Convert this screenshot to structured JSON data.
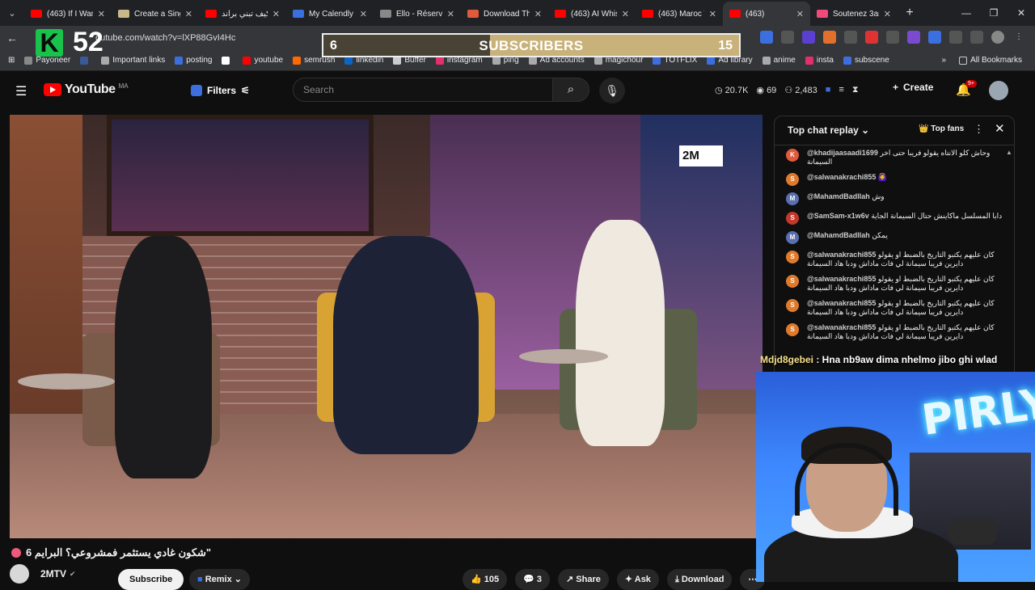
{
  "browser": {
    "tabs": [
      {
        "label": "(463) If I Want",
        "color": "#ff0000"
      },
      {
        "label": "Create a Single",
        "color": "#c9b98a"
      },
      {
        "label": "كيف تبني براند",
        "color": "#ff0000"
      },
      {
        "label": "My Calendly",
        "color": "#3b6fe0"
      },
      {
        "label": "Ello - Réservat",
        "color": "#888888"
      },
      {
        "label": "Download Th",
        "color": "#e05a3b"
      },
      {
        "label": "(463) AI Whisk",
        "color": "#ff0000"
      },
      {
        "label": "(463) Maroc T",
        "color": "#ff0000"
      },
      {
        "label": "(463)",
        "color": "#ff0000",
        "active": true
      },
      {
        "label": "Soutenez 3an",
        "color": "#ef4a7a"
      }
    ],
    "url": "outube.com/watch?v=lXP88GvI4Hc",
    "bookmarks": [
      {
        "label": "Payoneer",
        "color": "#888888"
      },
      {
        "label": "",
        "color": "#3b5998"
      },
      {
        "label": "Important links",
        "color": "#aaaaaa"
      },
      {
        "label": "posting",
        "color": "#3b6fe0"
      },
      {
        "label": "",
        "color": "#ffffff"
      },
      {
        "label": "youtube",
        "color": "#ff0000"
      },
      {
        "label": "semrush",
        "color": "#ff6a00"
      },
      {
        "label": "linkedin",
        "color": "#0a66c2"
      },
      {
        "label": "Buffer",
        "color": "#cccccc"
      },
      {
        "label": "instagram",
        "color": "#e1306c"
      },
      {
        "label": "ping",
        "color": "#aaaaaa"
      },
      {
        "label": "Ad accounts",
        "color": "#aaaaaa"
      },
      {
        "label": "magichour",
        "color": "#aaaaaa"
      },
      {
        "label": "TOTFLIX",
        "color": "#3b6fe0"
      },
      {
        "label": "Ad library",
        "color": "#3b6fe0"
      },
      {
        "label": "anime",
        "color": "#aaaaaa"
      },
      {
        "label": "insta",
        "color": "#e1306c"
      },
      {
        "label": "subscene",
        "color": "#3b6fe0"
      }
    ],
    "all_bookmarks": "All Bookmarks"
  },
  "stream": {
    "k_count": "52",
    "sub_left": "6",
    "sub_label": "SUBSCRIBERS",
    "sub_right": "15",
    "sub_progress": 0.4
  },
  "youtube": {
    "logo_text": "YouTube",
    "country": "MA",
    "filters_label": "Filters",
    "search_placeholder": "Search",
    "stats": [
      "20.7K",
      "69",
      "2,483"
    ],
    "create_label": "Create",
    "notif_badge": "9+"
  },
  "video": {
    "overlay_logo": "2M",
    "title": "شكون غادي يستثمر فمشروعي؟ البرايم 6\"",
    "channel": "2MTV",
    "subscribe": "Subscribe",
    "remix": "Remix",
    "likes": "105",
    "comments": "3",
    "share": "Share",
    "ask": "Ask",
    "download": "Download"
  },
  "chat": {
    "title": "Top chat replay",
    "top_fans": "Top fans",
    "messages": [
      {
        "author": "@khadijaasaadi1699",
        "text": "وحاش كلو الانتاه يقولو فريبا حتى اخر السيمانة",
        "initial": "K",
        "color": "#e05a3b"
      },
      {
        "author": "@salwanakrachi855",
        "text": "🙆‍♀️",
        "initial": "S",
        "color": "#e07a2b"
      },
      {
        "author": "@MahamdBadllah",
        "text": "وش",
        "initial": "M",
        "color": "#5a6fb0"
      },
      {
        "author": "@SamSam-x1w6v",
        "text": "دابا المسلسل ماكاينش حتال السيمانة الجاية",
        "initial": "S",
        "color": "#c0392b"
      },
      {
        "author": "@MahamdBadllah",
        "text": "يمكن",
        "initial": "M",
        "color": "#5a6fb0"
      },
      {
        "author": "@salwanakrachi855",
        "text": "كان عليهم يكتبو التاريخ بالضبط او يقولو دايرين فريبا سيمانة لي فات ماداش ودبا هاد السيمانة",
        "initial": "S",
        "color": "#e07a2b"
      },
      {
        "author": "@salwanakrachi855",
        "text": "كان عليهم يكتبو التاريخ بالضبط او يقولو دايرين فريبا سيمانة لي فات ماداش ودبا هاد السيمانة",
        "initial": "S",
        "color": "#e07a2b"
      },
      {
        "author": "@salwanakrachi855",
        "text": "كان عليهم يكتبو التاريخ بالضبط او يقولو دايرين فريبا سيمانة لي فات ماداش ودبا هاد السيمانة",
        "initial": "S",
        "color": "#e07a2b"
      },
      {
        "author": "@salwanakrachi855",
        "text": "كان عليهم يكتبو التاريخ بالضبط او يقولو دايرين فريبا سيمانة لي فات ماداش ودبا هاد السيمانة",
        "initial": "S",
        "color": "#e07a2b"
      }
    ]
  },
  "overlay_chat": {
    "author": "Mdjd8gebei",
    "text": " : Hna nb9aw dima nhelmo jibo ghi wlad"
  },
  "webcam": {
    "neon": "PIRLY"
  }
}
